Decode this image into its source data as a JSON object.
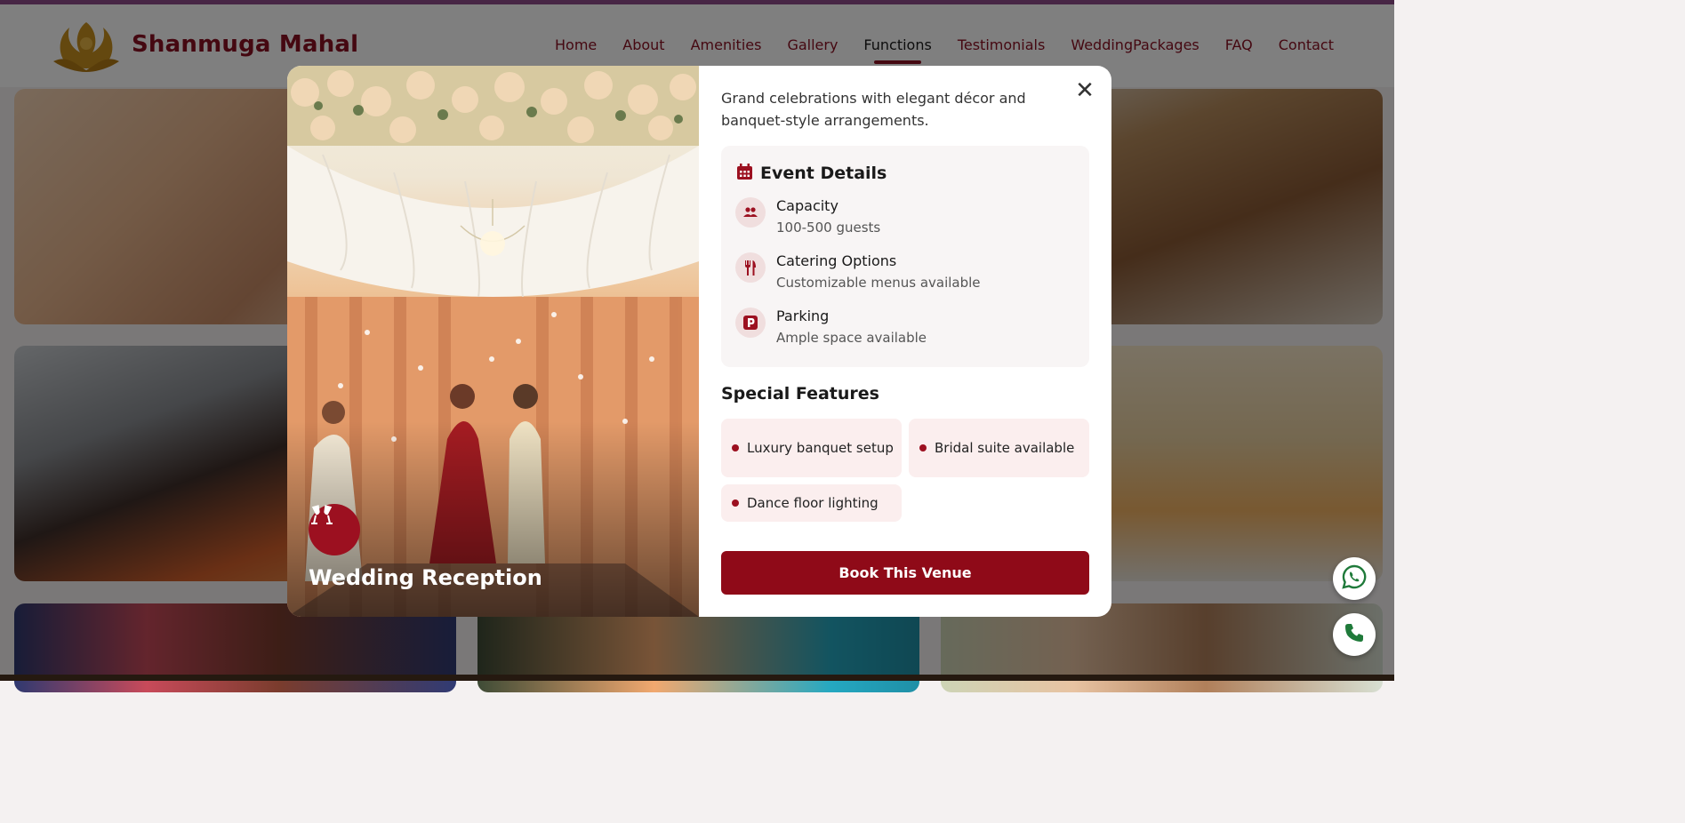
{
  "header": {
    "brand": "Shanmuga Mahal",
    "nav": [
      {
        "label": "Home"
      },
      {
        "label": "About"
      },
      {
        "label": "Amenities"
      },
      {
        "label": "Gallery"
      },
      {
        "label": "Functions",
        "active": true
      },
      {
        "label": "Testimonials"
      },
      {
        "label": "WeddingPackages"
      },
      {
        "label": "FAQ"
      },
      {
        "label": "Contact"
      }
    ]
  },
  "colors": {
    "primary": "#8f0a18",
    "brand_text": "#8a1023",
    "chip_bg": "#fbeeee",
    "details_bg": "#f8f5f5"
  },
  "modal": {
    "event_title": "Wedding Reception",
    "event_icon": "champagne-glasses-icon",
    "description": "Grand celebrations with elegant décor and banquet-style arrangements.",
    "details": {
      "title": "Event Details",
      "icon": "calendar-icon",
      "items": [
        {
          "icon": "users-icon",
          "label": "Capacity",
          "value": "100-500 guests"
        },
        {
          "icon": "utensils-icon",
          "label": "Catering Options",
          "value": "Customizable menus available"
        },
        {
          "icon": "parking-icon",
          "label": "Parking",
          "value": "Ample space available"
        }
      ]
    },
    "features": {
      "title": "Special Features",
      "items": [
        "Luxury banquet setup",
        "Bridal suite available",
        "Dance floor lighting"
      ]
    },
    "cta": "Book This Venue",
    "close_icon": "close-icon"
  },
  "floating_buttons": [
    {
      "icon": "whatsapp-icon"
    },
    {
      "icon": "phone-icon"
    }
  ]
}
